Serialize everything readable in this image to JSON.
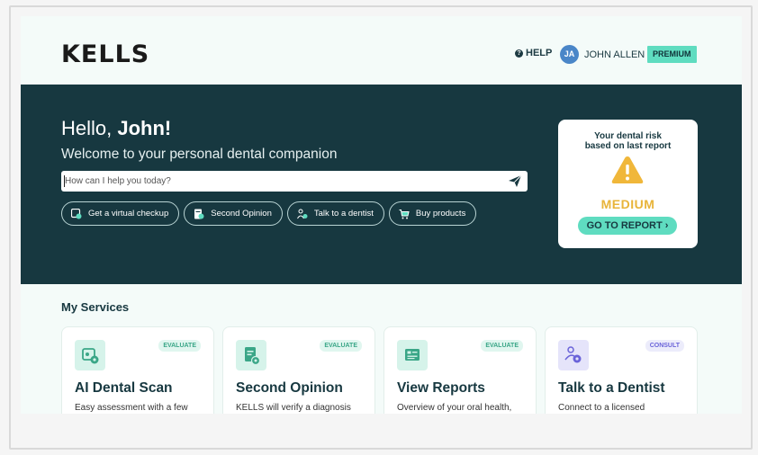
{
  "header": {
    "logo": "KELLS",
    "help_label": "HELP",
    "user_initials": "JA",
    "user_name": "JOHN ALLEN",
    "plan_badge": "PREMIUM"
  },
  "hero": {
    "greeting_prefix": "Hello, ",
    "greeting_name": "John!",
    "welcome": "Welcome to your personal dental companion",
    "ask_placeholder": "How can I help you today?",
    "chips": [
      {
        "label": "Get a virtual checkup",
        "icon": "scan-icon"
      },
      {
        "label": "Second Opinion",
        "icon": "document-check-icon"
      },
      {
        "label": "Talk to a dentist",
        "icon": "dentist-icon"
      },
      {
        "label": "Buy products",
        "icon": "cart-icon"
      }
    ]
  },
  "risk_card": {
    "title_line1": "Your dental risk",
    "title_line2": "based on last report",
    "level": "MEDIUM",
    "button": "GO TO REPORT ›",
    "level_color": "#e8b43a"
  },
  "services": {
    "title": "My Services",
    "cards": [
      {
        "title": "AI Dental Scan",
        "tag": "EVALUATE",
        "desc": "Easy assessment with a few",
        "icon": "scan-icon"
      },
      {
        "title": "Second Opinion",
        "tag": "EVALUATE",
        "desc": "KELLS will verify a diagnosis",
        "icon": "document-check-icon"
      },
      {
        "title": "View Reports",
        "tag": "EVALUATE",
        "desc": "Overview of your oral health,",
        "icon": "report-icon"
      },
      {
        "title": "Talk to a Dentist",
        "tag": "CONSULT",
        "desc": "Connect to a licensed",
        "icon": "dentist-icon"
      }
    ]
  },
  "colors": {
    "hero_bg": "#173840",
    "accent": "#5fdcc0",
    "warning": "#e8b43a"
  }
}
